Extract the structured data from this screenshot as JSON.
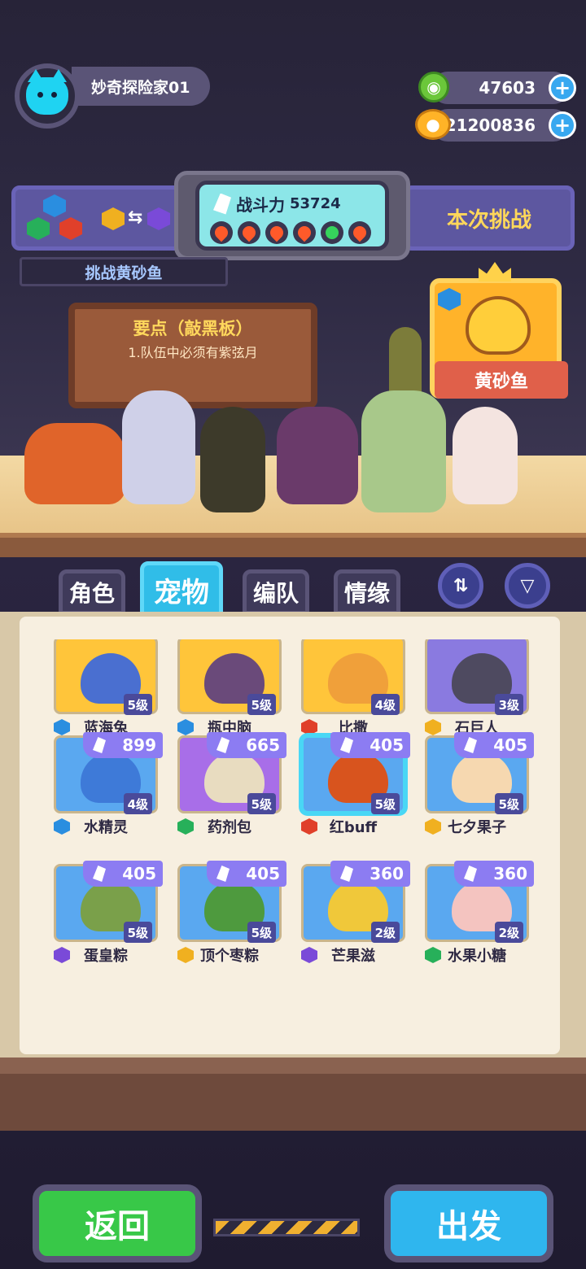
{
  "player": {
    "name": "妙奇探险家01"
  },
  "currency": [
    {
      "amount": "47603",
      "icon": "green-gem-icon",
      "color": "#6bc73a"
    },
    {
      "amount": "121200836",
      "icon": "gold-planet-icon",
      "color": "#ffb327"
    }
  ],
  "challenge": {
    "power_label": "战斗力",
    "power_value": "53724",
    "right_label": "本次挑战",
    "target_strip": "挑战黄砂鱼",
    "element_swap": "⇆"
  },
  "notice": {
    "title": "要点（敲黑板）",
    "text": "1.队伍中必须有紫弦月"
  },
  "boss": {
    "name": "黄砂鱼"
  },
  "tabs": [
    "角色",
    "宠物",
    "编队",
    "情缘"
  ],
  "active_tab": "宠物",
  "pets": [
    {
      "name": "蓝海兔",
      "level": "5级",
      "power": "",
      "element": "blue",
      "color": "#ffc53a",
      "blob": "#4a6fd0"
    },
    {
      "name": "瓶中脑",
      "level": "5级",
      "power": "",
      "element": "blue",
      "color": "#ffc53a",
      "blob": "#6a4a7a"
    },
    {
      "name": "比撒",
      "level": "4级",
      "power": "",
      "element": "red",
      "color": "#ffc53a",
      "blob": "#f0a03a"
    },
    {
      "name": "石巨人",
      "level": "3级",
      "power": "",
      "element": "gold",
      "color": "#8a7ae0",
      "blob": "#4e4a60"
    },
    {
      "name": "水精灵",
      "level": "4级",
      "power": "899",
      "element": "blue",
      "color": "#5aa8f0",
      "blob": "#3e7ad8"
    },
    {
      "name": "药剂包",
      "level": "5级",
      "power": "665",
      "element": "green",
      "color": "#a86ee8",
      "blob": "#e8dcc0"
    },
    {
      "name": "红buff",
      "level": "5级",
      "power": "405",
      "element": "red",
      "color": "#5aa8f0",
      "blob": "#d8541e"
    },
    {
      "name": "七夕果子",
      "level": "5级",
      "power": "405",
      "element": "gold",
      "color": "#5aa8f0",
      "blob": "#f6d8b0"
    },
    {
      "name": "蛋皇粽",
      "level": "5级",
      "power": "405",
      "element": "purple",
      "color": "#5aa8f0",
      "blob": "#7aa04a"
    },
    {
      "name": "顶个枣粽",
      "level": "5级",
      "power": "405",
      "element": "gold",
      "color": "#5aa8f0",
      "blob": "#4e9a3e"
    },
    {
      "name": "芒果滋",
      "level": "2级",
      "power": "360",
      "element": "purple",
      "color": "#5aa8f0",
      "blob": "#f0c83a"
    },
    {
      "name": "水果小糖",
      "level": "2级",
      "power": "360",
      "element": "green",
      "color": "#5aa8f0",
      "blob": "#f4c4c0"
    }
  ],
  "footer_hint": "",
  "buttons": {
    "back": "返回",
    "go": "出发"
  },
  "element_colors": {
    "blue": "#2a8ee0",
    "red": "#e0402a",
    "gold": "#f0b020",
    "green": "#27b05a",
    "purple": "#7a4ad8"
  }
}
